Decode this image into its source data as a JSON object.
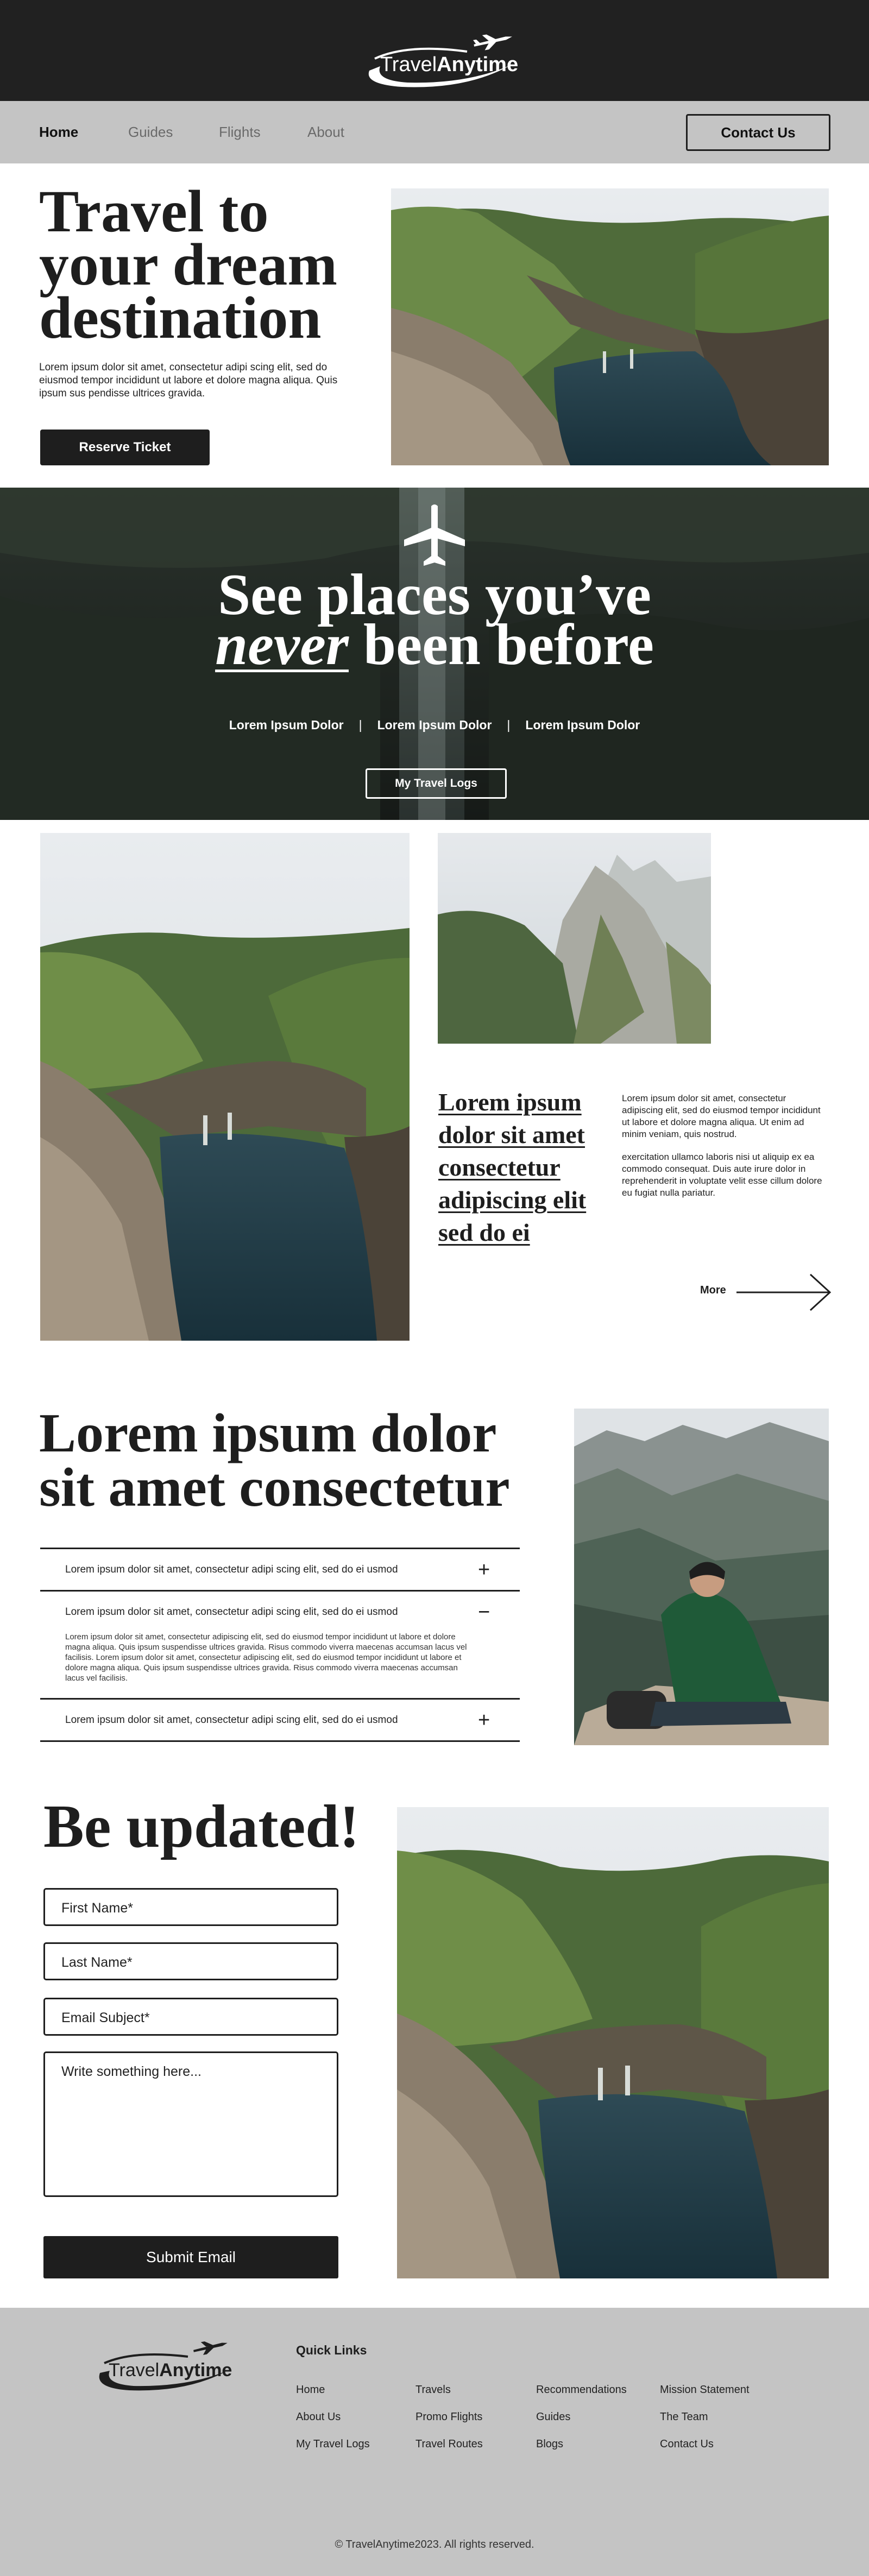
{
  "header": {
    "brand_light": "Travel",
    "brand_bold": "Anytime"
  },
  "nav": {
    "items": [
      {
        "label": "Home",
        "active": true
      },
      {
        "label": "Guides",
        "active": false
      },
      {
        "label": "Flights",
        "active": false
      },
      {
        "label": "About",
        "active": false
      }
    ],
    "contact_label": "Contact Us"
  },
  "hero": {
    "title": "Travel to your dream destination",
    "text": "Lorem ipsum dolor sit amet, consectetur adipi scing elit, sed do eiusmod tempor incididunt ut labore et dolore magna aliqua. Quis ipsum sus pendisse ultrices gravida.",
    "button_label": "Reserve Ticket"
  },
  "banner": {
    "title_line1": "See places you’ve",
    "title_never": "never",
    "title_line2_rest": " been before",
    "links": [
      "Lorem Ipsum Dolor",
      "Lorem Ipsum Dolor",
      "Lorem Ipsum Dolor"
    ],
    "separator": "|",
    "button_label": "My Travel Logs"
  },
  "feature": {
    "heading": "Lorem ipsum dolor sit amet consectetur adipiscing elit sed do ei",
    "paragraph1": "Lorem ipsum dolor sit amet, consectetur adipiscing elit, sed do eiusmod tempor incididunt ut labore et dolore magna aliqua. Ut enim ad minim veniam, quis nostrud.",
    "paragraph2": "exercitation ullamco laboris nisi ut aliquip ex ea commodo consequat. Duis aute irure dolor in reprehenderit in voluptate velit esse cillum dolore eu fugiat nulla pariatur.",
    "more_label": "More"
  },
  "faq": {
    "heading": "Lorem ipsum dolor sit amet consectetur",
    "items": [
      {
        "question": "Lorem ipsum dolor sit amet, consectetur adipi scing elit, sed do ei usmod",
        "sign": "+"
      },
      {
        "question": "Lorem ipsum dolor sit amet, consectetur adipi scing elit, sed do ei usmod",
        "sign": "−"
      },
      {
        "question": "Lorem ipsum dolor sit amet, consectetur adipi scing elit, sed do ei usmod",
        "sign": "+"
      }
    ],
    "answer": "Lorem ipsum dolor sit amet, consectetur adipiscing elit, sed do eiusmod tempor incididunt ut labore et dolore magna aliqua. Quis ipsum suspendisse ultrices gravida. Risus commodo viverra maecenas accumsan lacus vel facilisis. Lorem ipsum dolor sit amet, consectetur adipiscing elit, sed do eiusmod tempor incididunt ut labore et dolore magna aliqua. Quis ipsum suspendisse ultrices gravida. Risus commodo viverra maecenas accumsan lacus vel facilisis."
  },
  "form": {
    "heading": "Be updated!",
    "first_name": "First Name*",
    "last_name": "Last Name*",
    "email_subject": "Email Subject*",
    "message": "Write something here...",
    "submit_label": "Submit Email"
  },
  "footer": {
    "quick_links_title": "Quick Links",
    "columns": [
      [
        "Home",
        "About Us",
        "My Travel Logs"
      ],
      [
        "Travels",
        "Promo Flights",
        "Travel Routes"
      ],
      [
        "Recommendations",
        "Guides",
        "Blogs"
      ],
      [
        "Mission Statement",
        "The Team",
        "Contact Us"
      ]
    ],
    "copyright": "© TravelAnytime2023. All rights reserved."
  },
  "icons": {
    "logo_plane": "airplane-icon",
    "banner_plane": "airplane-icon",
    "more_arrow": "arrow-right-icon",
    "faq_expand": "plus-icon",
    "faq_collapse": "minus-icon"
  },
  "colors": {
    "dark": "#1e1e1e",
    "nav_bg": "#c4c4c4",
    "white": "#ffffff"
  }
}
